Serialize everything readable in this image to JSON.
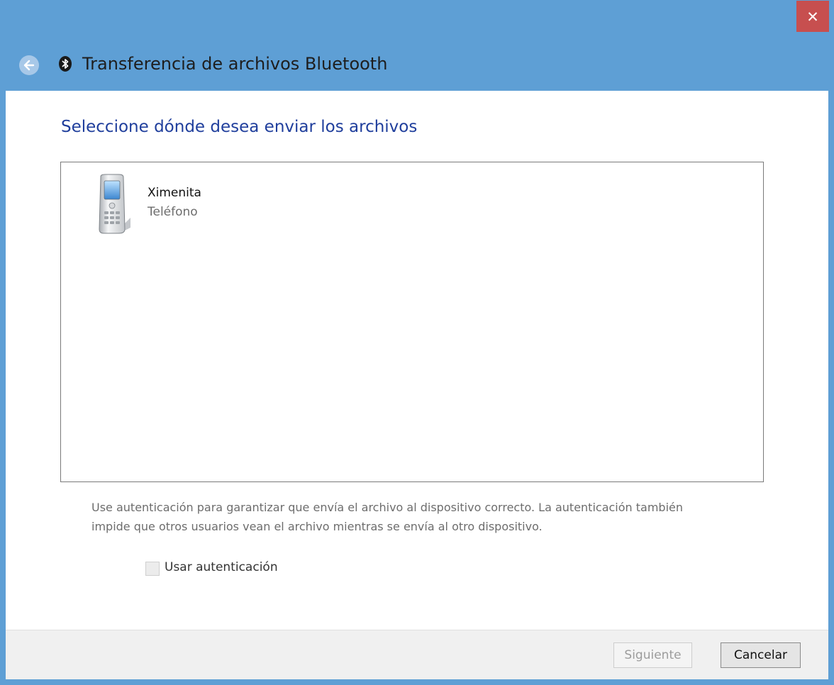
{
  "window": {
    "title": "Transferencia de archivos Bluetooth",
    "close_label": "✕"
  },
  "main": {
    "heading": "Seleccione dónde desea enviar los archivos",
    "devices": [
      {
        "name": "Ximenita",
        "type": "Teléfono",
        "icon": "mobile-phone-icon"
      }
    ],
    "info_text": "Use autenticación para garantizar que envía el archivo al dispositivo correcto. La autenticación también impide que otros usuarios vean el archivo mientras se envía al otro dispositivo.",
    "auth_checkbox": {
      "label": "Usar autenticación",
      "checked": false
    }
  },
  "footer": {
    "next_label": "Siguiente",
    "cancel_label": "Cancelar"
  },
  "colors": {
    "titlebar": "#5e9fd5",
    "heading": "#1f3e9c",
    "close": "#c74f4f"
  }
}
